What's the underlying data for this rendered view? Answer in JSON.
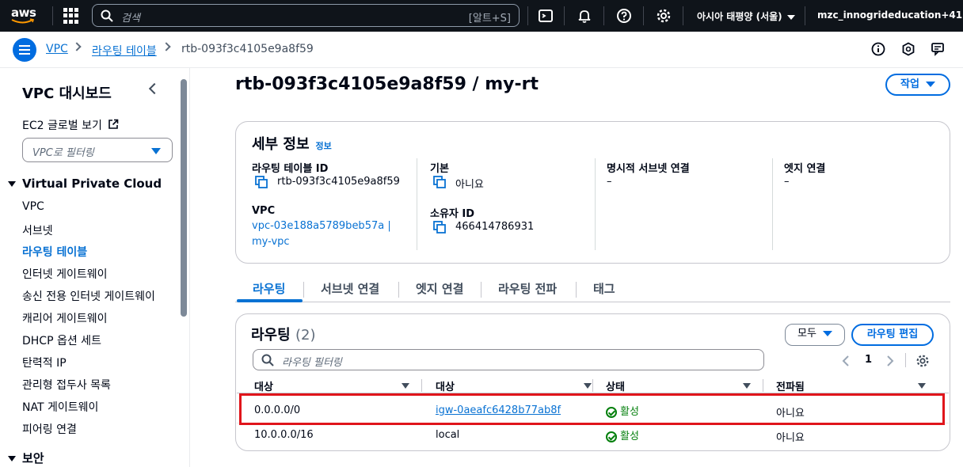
{
  "topbar": {
    "logo": "aws",
    "search_placeholder": "검색",
    "search_shortcut": "[알트+S]",
    "region": "아시아 태평양 (서울)",
    "account": "mzc_innogrideducation+41"
  },
  "breadcrumb": {
    "items": [
      "VPC",
      "라우팅 테이블"
    ],
    "current": "rtb-093f3c4105e9a8f59"
  },
  "sidebar": {
    "title": "VPC 대시보드",
    "ec2_global": "EC2 글로벌 보기",
    "filter_placeholder": "VPC로 필터링",
    "section_vpc": "Virtual Private Cloud",
    "items": [
      "VPC",
      "서브넷",
      "라우팅 테이블",
      "인터넷 게이트웨이",
      "송신 전용 인터넷 게이트웨이",
      "캐리어 게이트웨이",
      "DHCP 옵션 세트",
      "탄력적 IP",
      "관리형 접두사 목록",
      "NAT 게이트웨이",
      "피어링 연결"
    ],
    "section_security": "보안"
  },
  "page": {
    "title": "rtb-093f3c4105e9a8f59 / my-rt",
    "actions_label": "작업"
  },
  "details": {
    "heading": "세부 정보",
    "info": "정보",
    "rt_id_label": "라우팅 테이블 ID",
    "rt_id_value": "rtb-093f3c4105e9a8f59",
    "vpc_label": "VPC",
    "vpc_value_1": "vpc-03e188a5789beb57a |",
    "vpc_value_2": "my-vpc",
    "main_label": "기본",
    "main_value": "아니요",
    "owner_label": "소유자 ID",
    "owner_value": "466414786931",
    "explicit_label": "명시적 서브넷 연결",
    "explicit_value": "–",
    "edge_label": "엣지 연결",
    "edge_value": "–"
  },
  "tabs": [
    "라우팅",
    "서브넷 연결",
    "엣지 연결",
    "라우팅 전파",
    "태그"
  ],
  "routes": {
    "heading": "라우팅",
    "count": "(2)",
    "filter_label": "모두",
    "edit_label": "라우팅 편집",
    "filter_placeholder": "라우팅 필터링",
    "page": "1",
    "columns": [
      "대상",
      "대상",
      "상태",
      "전파됨"
    ],
    "rows": [
      {
        "destination": "0.0.0.0/0",
        "target": "igw-0aeafc6428b77ab8f",
        "status": "활성",
        "propagated": "아니요"
      },
      {
        "destination": "10.0.0.0/16",
        "target": "local",
        "status": "활성",
        "propagated": "아니요"
      }
    ]
  }
}
